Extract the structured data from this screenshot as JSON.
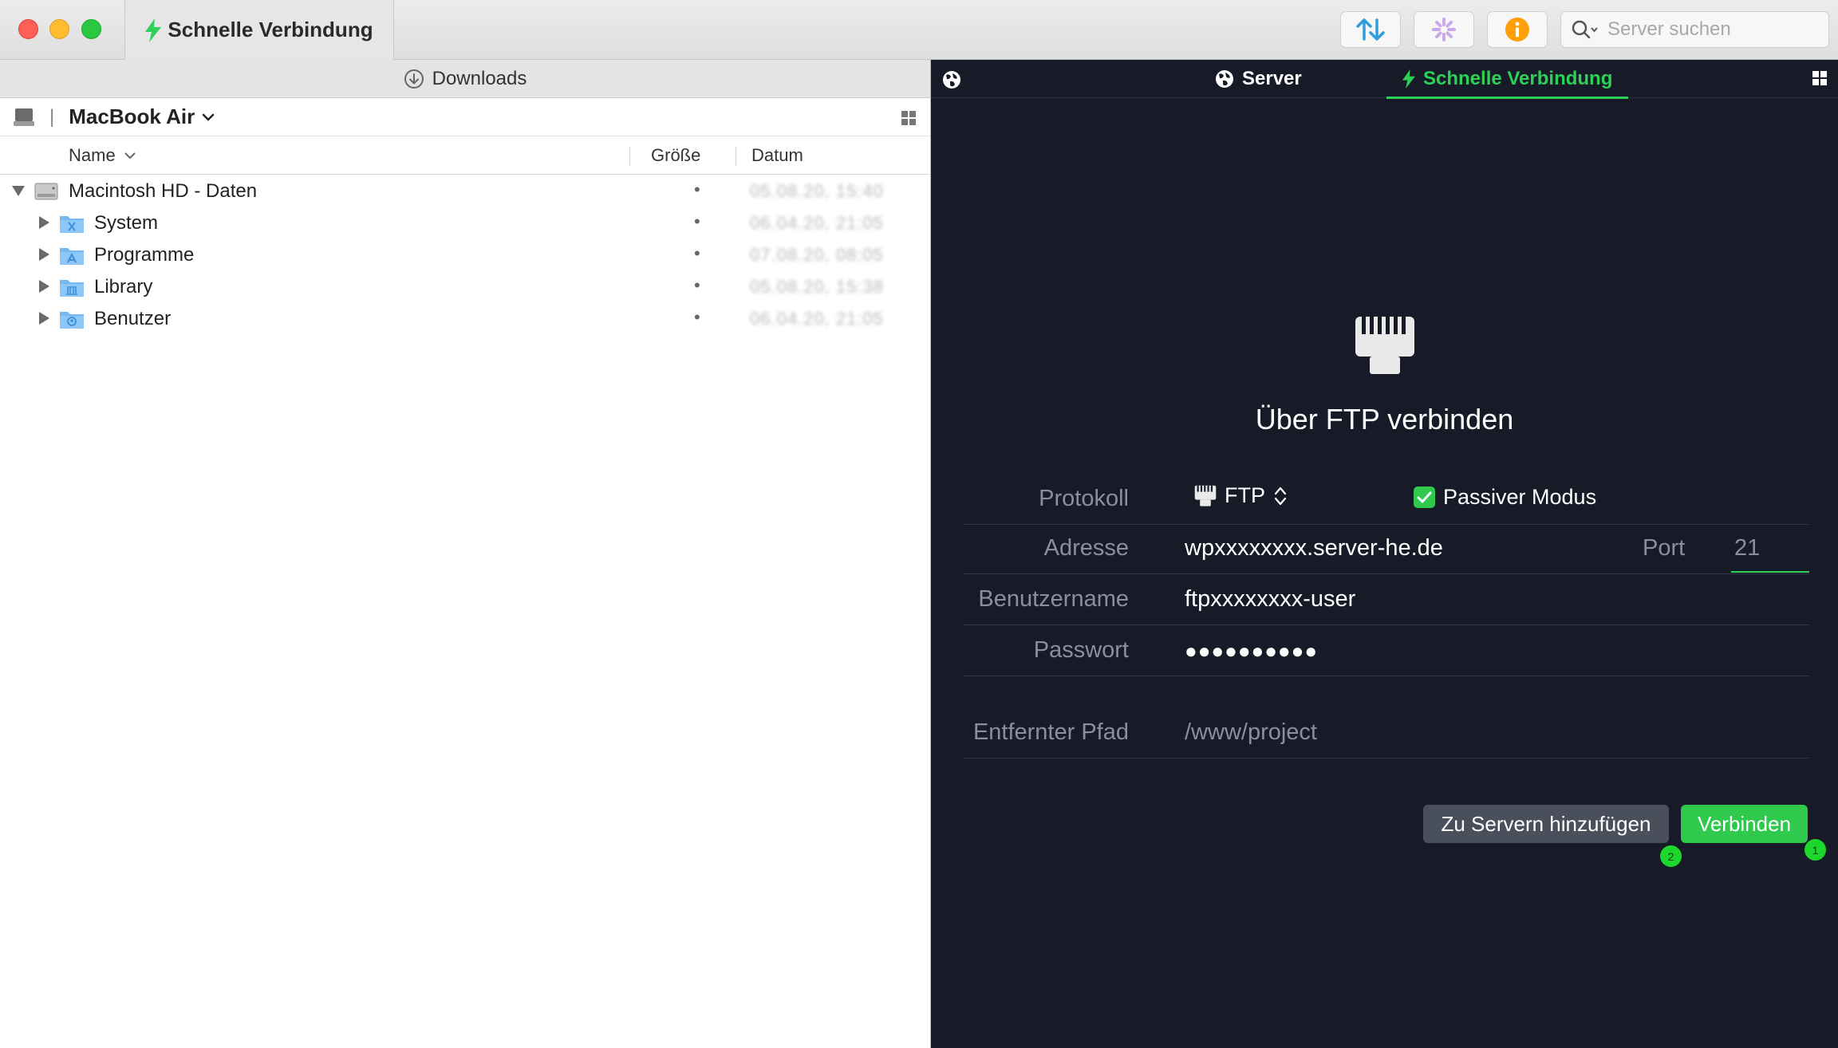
{
  "window": {
    "title": "Schnelle Verbindung"
  },
  "toolbar": {
    "search_placeholder": "Server suchen"
  },
  "left_pane": {
    "header": "Downloads",
    "location": "MacBook Air",
    "columns": {
      "name": "Name",
      "size": "Größe",
      "date": "Datum"
    },
    "rows": [
      {
        "name": "Macintosh HD - Daten",
        "size": "•",
        "date": "05.08.20, 15:40"
      },
      {
        "name": "System",
        "size": "•",
        "date": "06.04.20, 21:05"
      },
      {
        "name": "Programme",
        "size": "•",
        "date": "07.08.20, 08:05"
      },
      {
        "name": "Library",
        "size": "•",
        "date": "05.08.20, 15:38"
      },
      {
        "name": "Benutzer",
        "size": "•",
        "date": "06.04.20, 21:05"
      }
    ]
  },
  "right_pane": {
    "tabs": {
      "server": "Server",
      "quick": "Schnelle Verbindung"
    },
    "heading": "Über FTP verbinden",
    "form": {
      "protocol_label": "Protokoll",
      "protocol_value": "FTP",
      "passive_label": "Passiver Modus",
      "passive_checked": true,
      "address_label": "Adresse",
      "address_value": "wpxxxxxxxx.server-he.de",
      "port_label": "Port",
      "port_value": "21",
      "username_label": "Benutzername",
      "username_value": "ftpxxxxxxxx-user",
      "password_label": "Passwort",
      "password_value": "●●●●●●●●●●",
      "remote_path_label": "Entfernter Pfad",
      "remote_path_value": "/www/project"
    },
    "buttons": {
      "add": "Zu Servern hinzufügen",
      "connect": "Verbinden"
    },
    "badges": {
      "add": "2",
      "connect": "1"
    }
  },
  "colors": {
    "accent_green": "#2ed158",
    "right_bg": "#161b27",
    "info_orange": "#ff9f0a"
  }
}
